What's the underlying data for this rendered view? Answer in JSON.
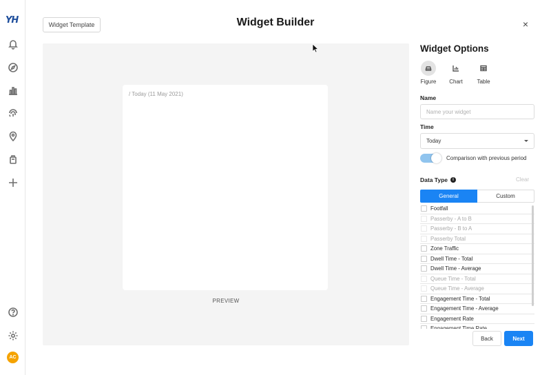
{
  "sidebar": {
    "logo": "YH",
    "avatar_initials": "AC",
    "icons": [
      "bell-icon",
      "compass-icon",
      "bar-chart-icon",
      "fingerprint-icon",
      "map-pin-icon",
      "shopping-bag-icon",
      "plus-icon",
      "help-icon",
      "gear-icon"
    ]
  },
  "header": {
    "template_button": "Widget Template",
    "title": "Widget Builder",
    "close_symbol": "×"
  },
  "preview": {
    "date_text": "/ Today (11 May 2021)",
    "label": "PREVIEW"
  },
  "options": {
    "title": "Widget Options",
    "types": [
      {
        "label": "Figure",
        "active": true
      },
      {
        "label": "Chart",
        "active": false
      },
      {
        "label": "Table",
        "active": false
      }
    ],
    "name_label": "Name",
    "name_placeholder": "Name your widget",
    "time_label": "Time",
    "time_value": "Today",
    "comparison_label": "Comparison with previous period",
    "comparison_enabled": true,
    "data_type_label": "Data Type",
    "clear_label": "Clear",
    "segments": {
      "general": "General",
      "custom": "Custom",
      "active": "general"
    },
    "data_types": [
      {
        "label": "Footfall",
        "enabled": true
      },
      {
        "label": "Passerby - A to B",
        "enabled": false
      },
      {
        "label": "Passerby - B to A",
        "enabled": false
      },
      {
        "label": "Passerby Total",
        "enabled": false
      },
      {
        "label": "Zone Traffic",
        "enabled": true
      },
      {
        "label": "Dwell Time - Total",
        "enabled": true
      },
      {
        "label": "Dwell Time - Average",
        "enabled": true
      },
      {
        "label": "Queue Time - Total",
        "enabled": false
      },
      {
        "label": "Queue Time - Average",
        "enabled": false
      },
      {
        "label": "Engagement Time - Total",
        "enabled": true
      },
      {
        "label": "Engagement Time - Average",
        "enabled": true
      },
      {
        "label": "Engagement Rate",
        "enabled": true
      },
      {
        "label": "Engagement Time Rate",
        "enabled": true
      }
    ],
    "back_label": "Back",
    "next_label": "Next"
  },
  "colors": {
    "accent": "#1a84f4",
    "toggle_on": "#90c4ee",
    "avatar": "#f5a300",
    "logo": "#1e4e9c"
  }
}
